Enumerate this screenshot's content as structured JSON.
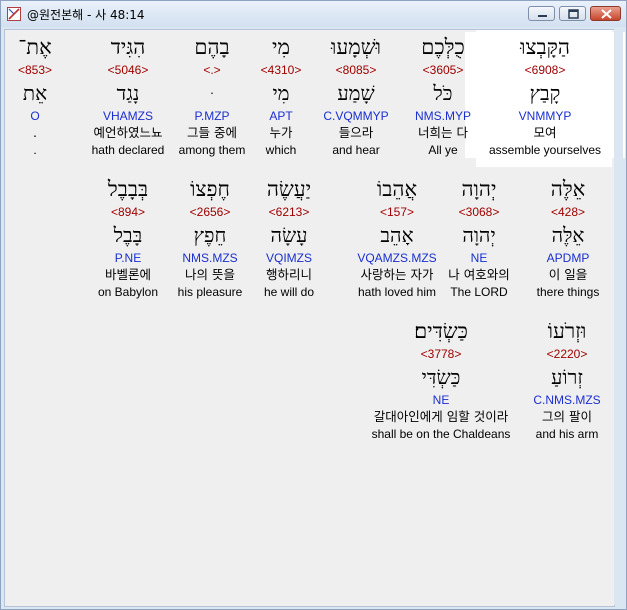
{
  "window": {
    "title": "@원전본해 - 사 48:14"
  },
  "words": [
    {
      "heb": "הַקָּבְצוּ",
      "strong": "<6908>",
      "heb2": "קָבַץ",
      "morph": "VNMMYP",
      "kor": "모여",
      "eng": "assemble yourselves",
      "highlight": true
    },
    {
      "heb": "כֻלְּכֶם",
      "strong": "<3605>",
      "heb2": "כֹּל",
      "morph": "NMS.MYP",
      "kor": "너희는 다",
      "eng": "All ye"
    },
    {
      "heb": "וּשְׁמָעוּ",
      "strong": "<8085>",
      "heb2": "שָׁמַע",
      "morph": "C.VQMMYP",
      "kor": "들으라",
      "eng": "and hear"
    },
    {
      "heb": "מִי",
      "strong": "<4310>",
      "heb2": "מִי",
      "morph": "APT",
      "kor": "누가",
      "eng": "which"
    },
    {
      "heb": "בָהֶם",
      "strong": "<.>",
      "heb2": "ּ",
      "morph": "P.MZP",
      "kor": "그들 중에",
      "eng": "among them"
    },
    {
      "heb": "הִגִּיד",
      "strong": "<5046>",
      "heb2": "נָגַד",
      "morph": "VHAMZS",
      "kor": "예언하였느뇨",
      "eng": "hath declared"
    },
    {
      "heb": "אֶת־",
      "strong": "<853>",
      "heb2": "אֵת",
      "morph": "O",
      "kor": ".",
      "eng": "."
    },
    {
      "heb": "אֵלֶּה",
      "strong": "<428>",
      "heb2": "אֵלֶּה",
      "morph": "APDMP",
      "kor": "이 일을",
      "eng": "there things"
    },
    {
      "heb": "יְהוָה",
      "strong": "<3068>",
      "heb2": "יְהוָה",
      "morph": "NE",
      "kor": "나 여호와의",
      "eng": "The LORD"
    },
    {
      "heb": "אֲהֵבוֹ",
      "strong": "<157>",
      "heb2": "אָהֵב",
      "morph": "VQAMZS.MZS",
      "kor": "사랑하는 자가",
      "eng": "hath loved him"
    },
    {
      "heb": "יַעֲשֶׂה",
      "strong": "<6213>",
      "heb2": "עָשָׂה",
      "morph": "VQIMZS",
      "kor": "행하리니",
      "eng": "he will do"
    },
    {
      "heb": "חֶפְצוֹ",
      "strong": "<2656>",
      "heb2": "חֵפֶץ",
      "morph": "NMS.MZS",
      "kor": "나의 뜻을",
      "eng": "his pleasure"
    },
    {
      "heb": "בְּבָבֶל",
      "strong": "<894>",
      "heb2": "בָּבֶל",
      "morph": "P.NE",
      "kor": "바벨론에",
      "eng": "on Babylon"
    },
    {
      "heb": "וּזְרֹעוֹ",
      "strong": "<2220>",
      "heb2": "זְרוֹעַ",
      "morph": "C.NMS.MZS",
      "kor": "그의 팔이",
      "eng": "and his arm"
    },
    {
      "heb": "כַּשְׂדִּים׃",
      "strong": "<3778>",
      "heb2": "כַּשְׂדִּי",
      "morph": "NE",
      "kor": "갈대아인에게 임할 것이라",
      "eng": "shall be on the Chaldeans"
    }
  ]
}
